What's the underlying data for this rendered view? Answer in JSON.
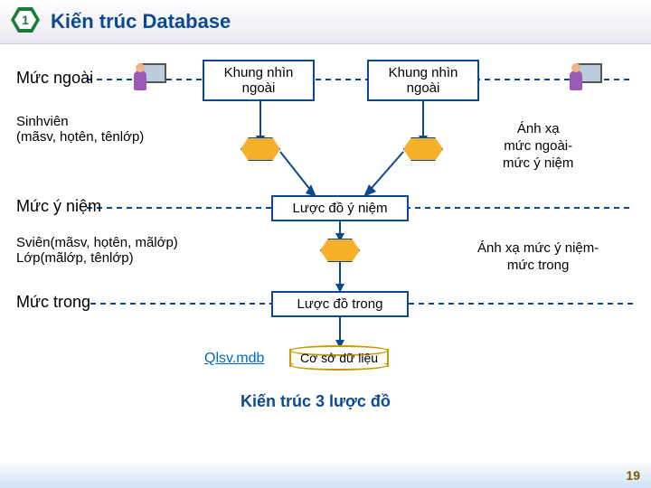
{
  "header": {
    "number": "1",
    "title": "Kiến trúc Database"
  },
  "levels": {
    "external": "Mức ngoài",
    "conceptual": "Mức ý niệm",
    "internal": "Mức trong"
  },
  "boxes": {
    "ext_view_1": "Khung nhìn\nngoài",
    "ext_view_2": "Khung nhìn\nngoài",
    "concept_schema": "Lược đồ ý niệm",
    "internal_schema": "Lược đồ trong",
    "database": "Cơ sở dữ liệu"
  },
  "schemas": {
    "ext_example": "Sinhviên\n(mãsv, họtên, tênlớp)",
    "concept_example": "Sviên(mãsv, họtên, mãlớp)\nLớp(mãlớp, tênlớp)"
  },
  "mappings": {
    "ext_concept": "Ánh xạ\nmức ngoài-\nmức ý niệm",
    "concept_int": "Ánh xạ mức ý niệm-\nmức trong"
  },
  "db_file": "Qlsv.mdb",
  "caption": "Kiến trúc 3 lược đồ",
  "page": "19"
}
